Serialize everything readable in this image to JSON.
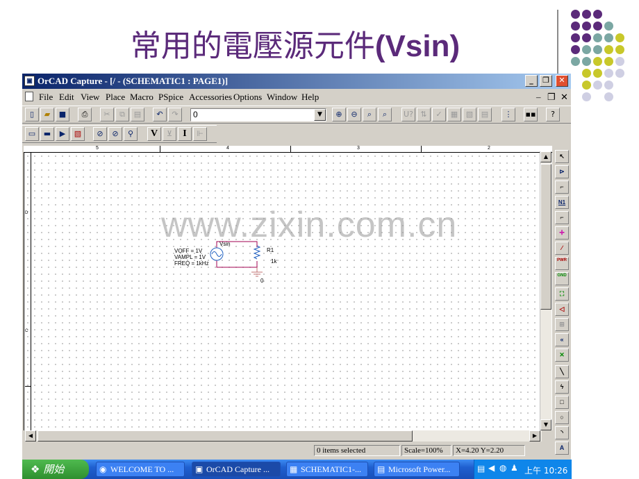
{
  "slide": {
    "title_cjk": "常用的電壓源元件",
    "title_latin": "(Vsin)",
    "watermark": "www.zixin.com.cn"
  },
  "window": {
    "title": "OrCAD Capture - [/ - (SCHEMATIC1 : PAGE1)]",
    "menu": [
      "File",
      "Edit",
      "View",
      "Place",
      "Macro",
      "PSpice",
      "Accessories",
      "Options",
      "Window",
      "Help"
    ],
    "combo_value": "0"
  },
  "ruler": [
    "5",
    "4",
    "3",
    "2"
  ],
  "side_marks": [
    "D",
    "C"
  ],
  "schematic": {
    "source_name": "Vsin",
    "voff": "VOFF = 1V",
    "vampl": "VAMPL = 1V",
    "freq": "FREQ = 1kHz",
    "resistor_ref": "R1",
    "resistor_value": "1k",
    "ground_label": "0"
  },
  "palette": [
    "N1",
    "PWR",
    "GND"
  ],
  "status": {
    "selection": "0 items selected",
    "scale": "Scale=100%",
    "coords": "X=4.20  Y=2.20"
  },
  "taskbar": {
    "start_label": "開始",
    "tasks": [
      "WELCOME TO ...",
      "OrCAD Capture ...",
      "SCHEMATIC1-...",
      "Microsoft Power..."
    ],
    "clock": "上午 10:26"
  },
  "colors": {
    "title": "#5b2a7a",
    "dot_purple": "#5b2a7a",
    "dot_teal": "#7ba7a3",
    "dot_yellow": "#c8c82a",
    "dot_lavender": "#cfcfe3",
    "wire": "#a00050",
    "ground": "#c07070"
  }
}
